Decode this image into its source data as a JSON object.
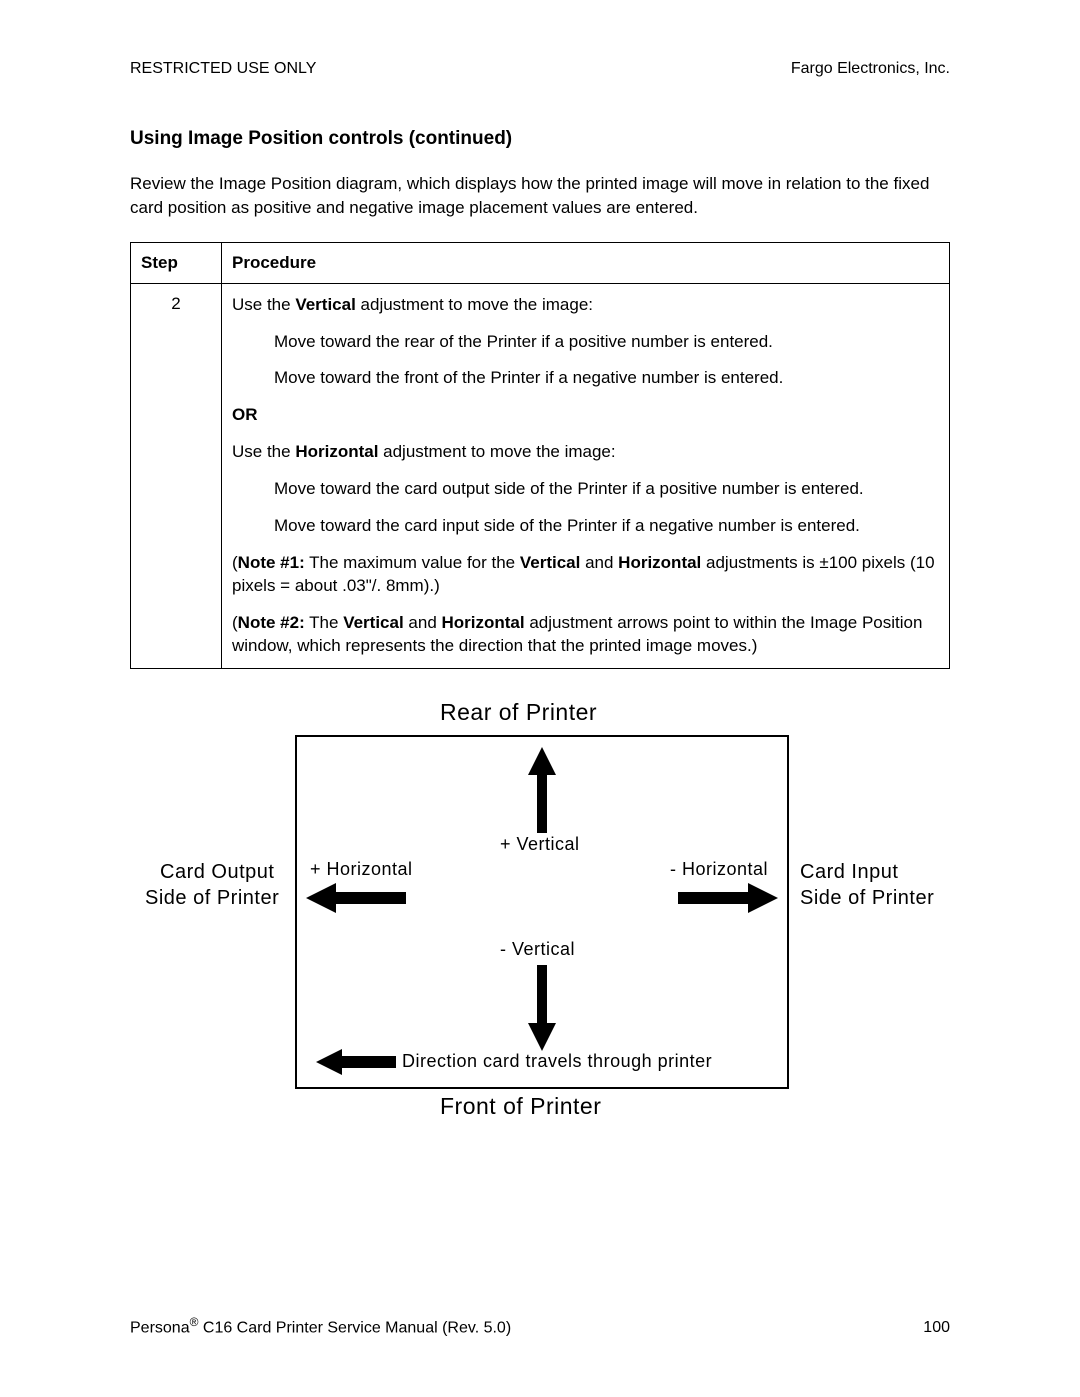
{
  "header": {
    "left": "RESTRICTED USE ONLY",
    "right": "Fargo Electronics, Inc."
  },
  "section_title": "Using Image Position controls (continued)",
  "intro": "Review the Image Position diagram, which displays how the printed image will move in relation to the fixed card position as positive and negative image placement values are entered.",
  "table": {
    "head_step": "Step",
    "head_proc": "Procedure",
    "step_num": "2",
    "p1_a": "Use the ",
    "p1_bold": "Vertical",
    "p1_b": " adjustment to move the image:",
    "p2": "Move toward the rear of the Printer if a positive number is entered.",
    "p3": "Move toward the front of the Printer if a negative number is entered.",
    "p4": "OR",
    "p5_a": "Use the ",
    "p5_bold": "Horizontal",
    "p5_b": " adjustment to move the image:",
    "p6": "Move toward the card output side of the Printer if a positive number is entered.",
    "p7": "Move toward the card input side of the Printer if a negative number is entered.",
    "p8_a": "(",
    "p8_bold1": "Note #1:",
    "p8_b": "  The maximum value for the ",
    "p8_bold2": "Vertical",
    "p8_c": " and ",
    "p8_bold3": "Horizontal",
    "p8_d": " adjustments is ±100 pixels (10 pixels = about .03\"/. 8mm).)",
    "p9_a": "(",
    "p9_bold1": "Note #2:",
    "p9_b": "  The ",
    "p9_bold2": "Vertical",
    "p9_c": " and ",
    "p9_bold3": "Horizontal",
    "p9_d": " adjustment arrows point to within the Image Position window, which represents the direction that the printed image moves.)"
  },
  "diagram": {
    "rear": "Rear of Printer",
    "front": "Front of Printer",
    "plus_v": "+ Vertical",
    "minus_v": "- Vertical",
    "plus_h": "+ Horizontal",
    "minus_h": "- Horizontal",
    "card_out_1": "Card Output",
    "card_out_2": "Side of Printer",
    "card_in_1": "Card Input",
    "card_in_2": "Side of Printer",
    "direction": "Direction card travels through printer"
  },
  "footer": {
    "left_a": "Persona",
    "left_reg": "®",
    "left_b": " C16 Card Printer Service Manual (Rev. 5.0)",
    "page": "100"
  }
}
